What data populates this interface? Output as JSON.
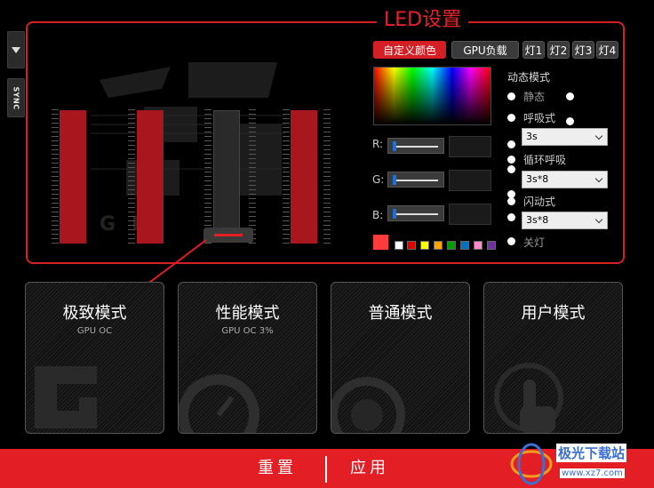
{
  "led_panel": {
    "title": "LED设置"
  },
  "side": {
    "sync_label": "SYNC"
  },
  "top_buttons": {
    "custom_color": "自定义颜色",
    "gpu_load": "GPU负载",
    "lamps": [
      "灯1",
      "灯2",
      "灯3",
      "灯4"
    ]
  },
  "rgb": {
    "r_label": "R:",
    "g_label": "G:",
    "b_label": "B:"
  },
  "swatches": [
    "#ff3b3b",
    "#ffffff",
    "#e00000",
    "#ffff00",
    "#ffa500",
    "#00a000",
    "#0070c0",
    "#ff88c8",
    "#7030a0"
  ],
  "dynamic": {
    "title": "动态模式",
    "static": "静态",
    "breathing": "呼吸式",
    "breathing_value": "3s",
    "cycle_breathing": "循环呼吸",
    "cycle_value": "3s*8",
    "flash": "闪动式",
    "flash_value": "3s*8",
    "off": "关灯"
  },
  "modes": [
    {
      "name": "极致模式",
      "sub": "GPU OC"
    },
    {
      "name": "性能模式",
      "sub": "GPU OC 3%"
    },
    {
      "name": "普通模式",
      "sub": ""
    },
    {
      "name": "用户模式",
      "sub": ""
    }
  ],
  "footer": {
    "reset": "重置",
    "apply": "应用"
  },
  "watermark": {
    "text": "极光下载站",
    "url": "www.xz7.com"
  },
  "colors": {
    "accent": "#e41e25",
    "panel_border": "#d41f24"
  }
}
